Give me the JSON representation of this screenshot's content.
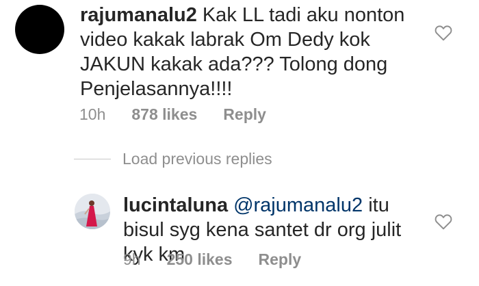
{
  "comment": {
    "username": "rajumanalu2",
    "text": "Kak LL tadi aku nonton video kakak labrak Om Dedy kok JAKUN kakak ada??? Tolong dong Penjelasannya!!!!",
    "time": "10h",
    "likes": "878 likes",
    "reply_label": "Reply",
    "avatar_color": "#000000",
    "like_icon": "heart-outline-icon"
  },
  "load_previous": {
    "label": "Load previous replies"
  },
  "reply": {
    "username": "lucintaluna",
    "mention": "@rajumanalu2",
    "text": "itu bisul syg kena santet dr org julit kyk km",
    "time": "9h",
    "likes": "250 likes",
    "reply_label": "Reply",
    "mention_color": "#003569",
    "like_icon": "heart-outline-icon"
  },
  "colors": {
    "text": "#262626",
    "meta": "#8e8e8e",
    "divider": "#c7c7c7"
  }
}
